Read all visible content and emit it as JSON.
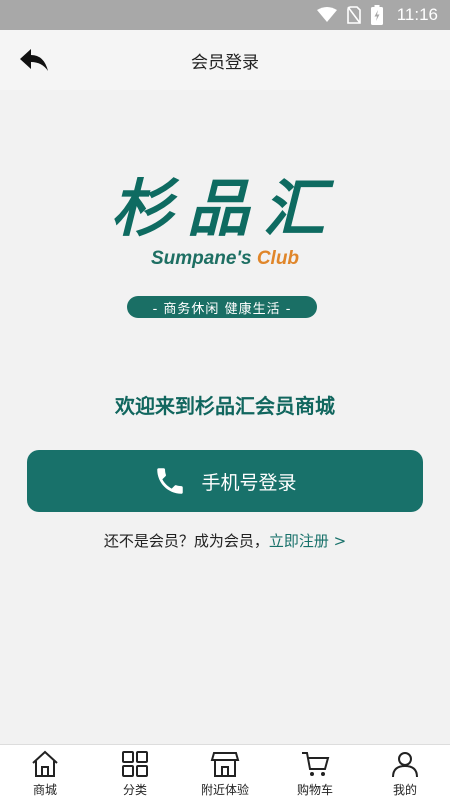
{
  "status_bar": {
    "time": "11:16"
  },
  "nav": {
    "title": "会员登录"
  },
  "logo": {
    "cn": "杉品汇",
    "en_main": "Sumpane's ",
    "en_club": "Club",
    "slogan": "- 商务休闲  健康生活 -"
  },
  "welcome": "欢迎来到杉品汇会员商城",
  "login_button": {
    "label": "手机号登录"
  },
  "register": {
    "prompt": "还不是会员？成为会员，",
    "link": "立即注册 >"
  },
  "tabs": [
    {
      "label": "商城",
      "icon": "home-icon"
    },
    {
      "label": "分类",
      "icon": "grid-icon"
    },
    {
      "label": "附近体验",
      "icon": "store-icon"
    },
    {
      "label": "购物车",
      "icon": "cart-icon"
    },
    {
      "label": "我的",
      "icon": "user-icon"
    }
  ],
  "colors": {
    "brand": "#18716a",
    "accent": "#e0862a",
    "status_bar": "#a8a8a8"
  }
}
